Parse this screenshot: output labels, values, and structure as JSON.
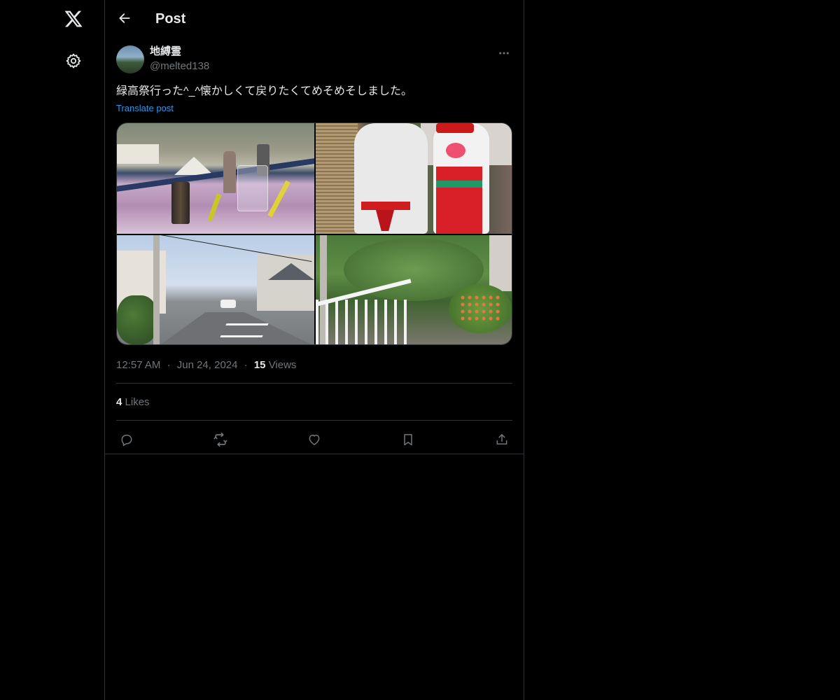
{
  "nav": {
    "logo_icon": "x-logo-icon",
    "settings_icon": "gear-icon"
  },
  "header": {
    "back_icon": "arrow-left-icon",
    "title": "Post"
  },
  "post": {
    "author": {
      "name": "地縛霊",
      "handle": "@melted138"
    },
    "more_icon": "more-horizontal-icon",
    "text": "緑高祭行った^_^懐かしくて戻りたくてめそめそしました。",
    "translate_label": "Translate post",
    "media": [
      {
        "name": "photo-festival-table"
      },
      {
        "name": "photo-cutout-figures"
      },
      {
        "name": "photo-residential-street"
      },
      {
        "name": "photo-greenery-railing"
      }
    ],
    "meta": {
      "time": "12:57 AM",
      "separator": "·",
      "date": "Jun 24, 2024",
      "views_count": "15",
      "views_label": "Views"
    },
    "likes": {
      "count": "4",
      "label": "Likes"
    },
    "actions": {
      "reply_icon": "reply-icon",
      "repost_icon": "repost-icon",
      "like_icon": "heart-icon",
      "bookmark_icon": "bookmark-icon",
      "share_icon": "share-icon"
    }
  },
  "colors": {
    "background": "#000000",
    "text_primary": "#e7e9ea",
    "text_secondary": "#71767b",
    "link": "#1d9bf0",
    "border": "#2f3336"
  }
}
